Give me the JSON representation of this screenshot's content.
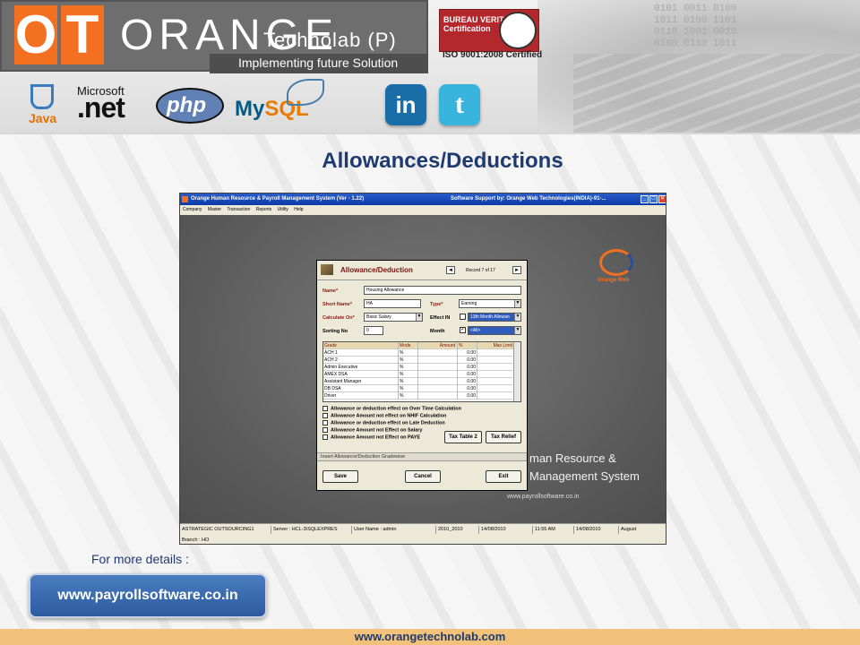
{
  "header": {
    "logo_o": "O",
    "logo_t": "T",
    "brand": "ORANGE",
    "technolab": "Technolab (P) LTD",
    "motto": "Implementing future Solution",
    "cert_line1": "BUREAU VERITAS",
    "cert_line2": "Certification",
    "iso": "ISO 9001:2008 Certified",
    "tech": {
      "java": "Java",
      "microsoft": "Microsoft",
      "net": ".net",
      "php": "php",
      "mysql_a": "My",
      "mysql_b": "SQL",
      "linkedin": "in",
      "twitter": "t"
    },
    "code_bits": "0101 0011 0100\n1011 0100 1101\n0110 1001 0010\n0100 0110 1011"
  },
  "page_title": "Allowances/Deductions",
  "app": {
    "window_title": "Orange Human Resource & Payroll Management System (Ver - 1.22)",
    "support": "Software Support by: Orange Web Technologies(INDIA)-91-...",
    "menu": [
      "Company",
      "Master",
      "Transaction",
      "Reports",
      "Utility",
      "Help"
    ],
    "brand_logo": "Orange Web",
    "bg_text_line1": "man Resource &",
    "bg_text_line2": "Management System",
    "site": "www.payrollsoftware.co.in",
    "dialog": {
      "title": "Allowance/Deduction",
      "record": "Record 7 of 17",
      "prev": "◄",
      "next": "►",
      "name_label": "Name*",
      "name_value": "Housing Allowance",
      "short_label": "Short Name*",
      "short_value": "HA",
      "type_label": "Type*",
      "type_value": "Earning",
      "calc_label": "Calculate On*",
      "calc_value": "Basic Salary",
      "effect_label": "Effect IN",
      "effect_value": "13th Month Allowan",
      "sorting_label": "Sorting No",
      "sorting_value": "0",
      "month_label": "Month",
      "month_value": "<All>",
      "grid_headers": [
        "Grade",
        "Mode",
        "Amount",
        "%",
        "Max Limit"
      ],
      "grid_rows": [
        {
          "grade": "ACH 1",
          "mode": "%",
          "pct": "0.00"
        },
        {
          "grade": "ACH 2",
          "mode": "%",
          "pct": "0.00"
        },
        {
          "grade": "Admin Executive",
          "mode": "%",
          "pct": "0.00"
        },
        {
          "grade": "AMEX DSA",
          "mode": "%",
          "pct": "0.00"
        },
        {
          "grade": "Assistant Manager",
          "mode": "%",
          "pct": "0.00"
        },
        {
          "grade": "DB DSA",
          "mode": "%",
          "pct": "0.00"
        },
        {
          "grade": "Driver",
          "mode": "%",
          "pct": "0.00"
        }
      ],
      "options": [
        "Allowance or deduction effect on Over Time Calculation",
        "Allowance Amount not effect on NHIF Calculation",
        "Allowance or deduction effect on Late Deduction",
        "Allowance Amount not Effect on Salary",
        "Allowance Amount not Effect on PAYE"
      ],
      "tax_table": "Tax Table 2",
      "tax_relief": "Tax Relief",
      "insert": "Insert Allowance/Deduction Gradewise",
      "save": "Save",
      "cancel": "Cancel",
      "exit": "Exit"
    },
    "status": [
      "ASTRATEGIC OUTSOURCING1",
      "Server : HCL-3\\SQLEXPRES",
      "User Name : admin",
      "2010_2010",
      "14/08/2010",
      "11:55 AM",
      "14/08/2010",
      "August"
    ],
    "branch": "Branch : HO"
  },
  "more_details": "For more details :",
  "url_button": "www.payrollsoftware.co.in",
  "footer_url": "www.orangetechnolab.com"
}
